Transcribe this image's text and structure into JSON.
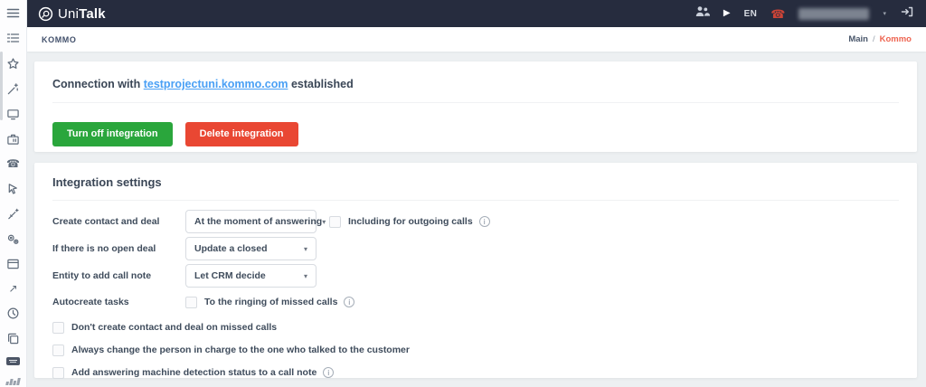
{
  "colors": {
    "topbar_bg": "#262c3e",
    "green_button": "#2aa63c",
    "red_button": "#e94733",
    "link_blue": "#4aa0f5",
    "breadcrumb_current": "#ee6450",
    "sidebar_icon": "#5f6b7a"
  },
  "topbar": {
    "logo_uni": "Uni",
    "logo_talk": "Talk",
    "language": "EN",
    "glyphs": {
      "play": "▶",
      "phone": "☎",
      "caret": "▾"
    }
  },
  "sidebar": {
    "glyphs": {
      "phone": "☎",
      "arrow_up_right": "↗"
    }
  },
  "page_header": {
    "title": "KOMMO",
    "breadcrumb_main": "Main",
    "breadcrumb_separator": "/",
    "breadcrumb_current": "Kommo"
  },
  "connection_card": {
    "text_prefix": "Connection with",
    "domain_link": "testprojectuni.kommo.com",
    "text_suffix": "established",
    "turn_off_button": "Turn off integration",
    "delete_button": "Delete integration"
  },
  "settings_card": {
    "title": "Integration settings",
    "create_contact": {
      "label": "Create contact and deal",
      "value": "At the moment of answering",
      "checkbox_label": "Including for outgoing calls",
      "info_glyph": "i"
    },
    "no_open_deal": {
      "label": "If there is no open deal",
      "value": "Update a closed"
    },
    "entity_note": {
      "label": "Entity to add call note",
      "value": "Let CRM decide"
    },
    "autocreate": {
      "label": "Autocreate tasks",
      "checkbox_label": "To the ringing of missed calls",
      "info_glyph": "i"
    },
    "options": [
      {
        "label": "Don't create contact and deal on missed calls"
      },
      {
        "label": "Always change the person in charge to the one who talked to the customer"
      },
      {
        "label": "Add answering machine detection status to a call note",
        "info_glyph": "i"
      }
    ],
    "select_caret": "▾"
  }
}
